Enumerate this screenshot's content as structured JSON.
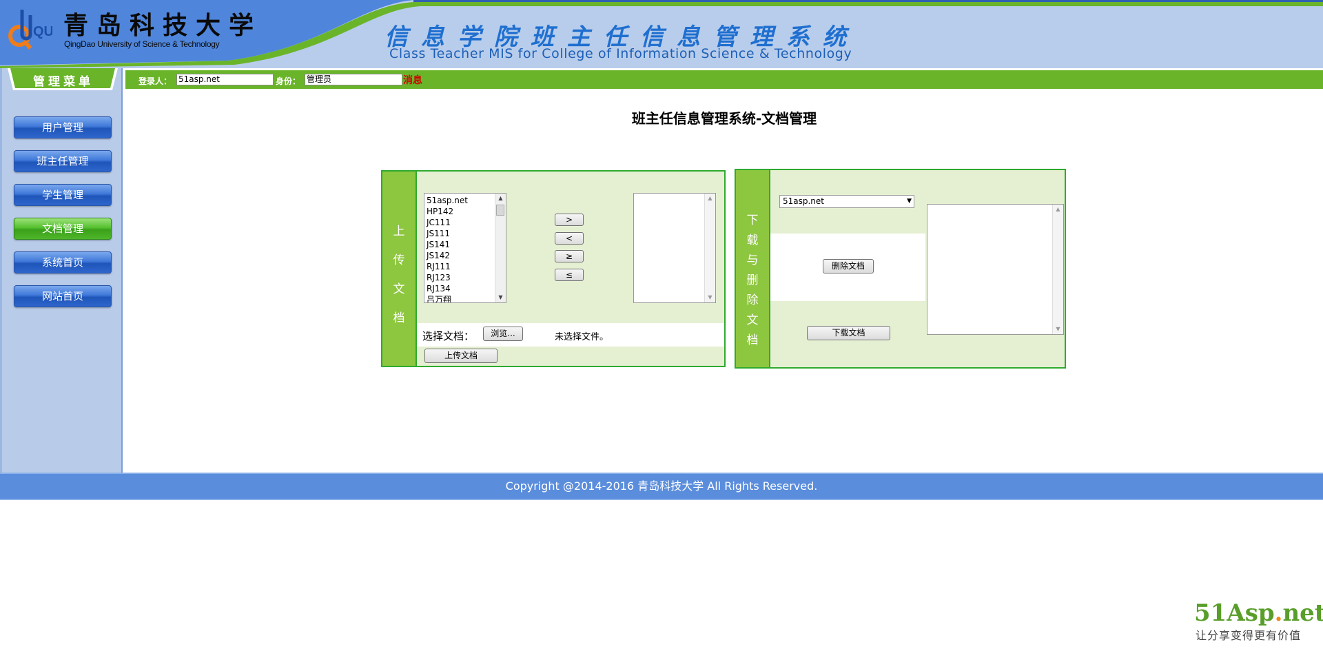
{
  "header": {
    "university_cn": "青岛科技大学",
    "university_en": "QingDao University of Science & Technology",
    "logo_text": "QUST",
    "system_cn": "信息学院班主任信息管理系统",
    "system_en": "Class Teacher MIS for College of Information Science & Technology"
  },
  "sidebar": {
    "title": "管理菜单",
    "items": [
      {
        "label": "用户管理",
        "active": false
      },
      {
        "label": "班主任管理",
        "active": false
      },
      {
        "label": "学生管理",
        "active": false
      },
      {
        "label": "文档管理",
        "active": true
      },
      {
        "label": "系统首页",
        "active": false
      },
      {
        "label": "网站首页",
        "active": false
      }
    ]
  },
  "infobar": {
    "login_label": "登录人：",
    "login_value": "51asp.net",
    "role_label": "身份：",
    "role_value": "管理员",
    "message_link": "消息"
  },
  "page_title": "班主任信息管理系统-文档管理",
  "upload": {
    "side_label": [
      "上",
      "传",
      "文",
      "档"
    ],
    "source_items": [
      "51asp.net",
      "HP142",
      "JC111",
      "JS111",
      "JS141",
      "JS142",
      "RJ111",
      "RJ123",
      "RJ134",
      "吕万翔"
    ],
    "move_buttons": [
      ">",
      "<",
      "≥",
      "≤"
    ],
    "choose_label": "选择文档：",
    "browse_button": "浏览...",
    "no_file_text": "未选择文件。",
    "upload_button": "上传文档"
  },
  "download": {
    "side_label": [
      "下",
      "载",
      "与",
      "删",
      "除",
      "文",
      "档"
    ],
    "selected_user": "51asp.net",
    "delete_button": "删除文档",
    "download_button": "下载文档"
  },
  "footer": {
    "copyright": "Copyright @2014-2016 青岛科技大学 All Rights Reserved."
  },
  "watermark": {
    "brand_main": "51Asp",
    "brand_dot": ".",
    "brand_tld": "net",
    "slogan": "让分享变得更有价值"
  },
  "colors": {
    "header_bg": "#b8cdeb",
    "header_blue": "#4a80d8",
    "green_bar": "#6ab42a",
    "panel_border": "#2eaa2e",
    "panel_bg": "#e5f0d3",
    "footer_bg": "#5a8ddc"
  }
}
